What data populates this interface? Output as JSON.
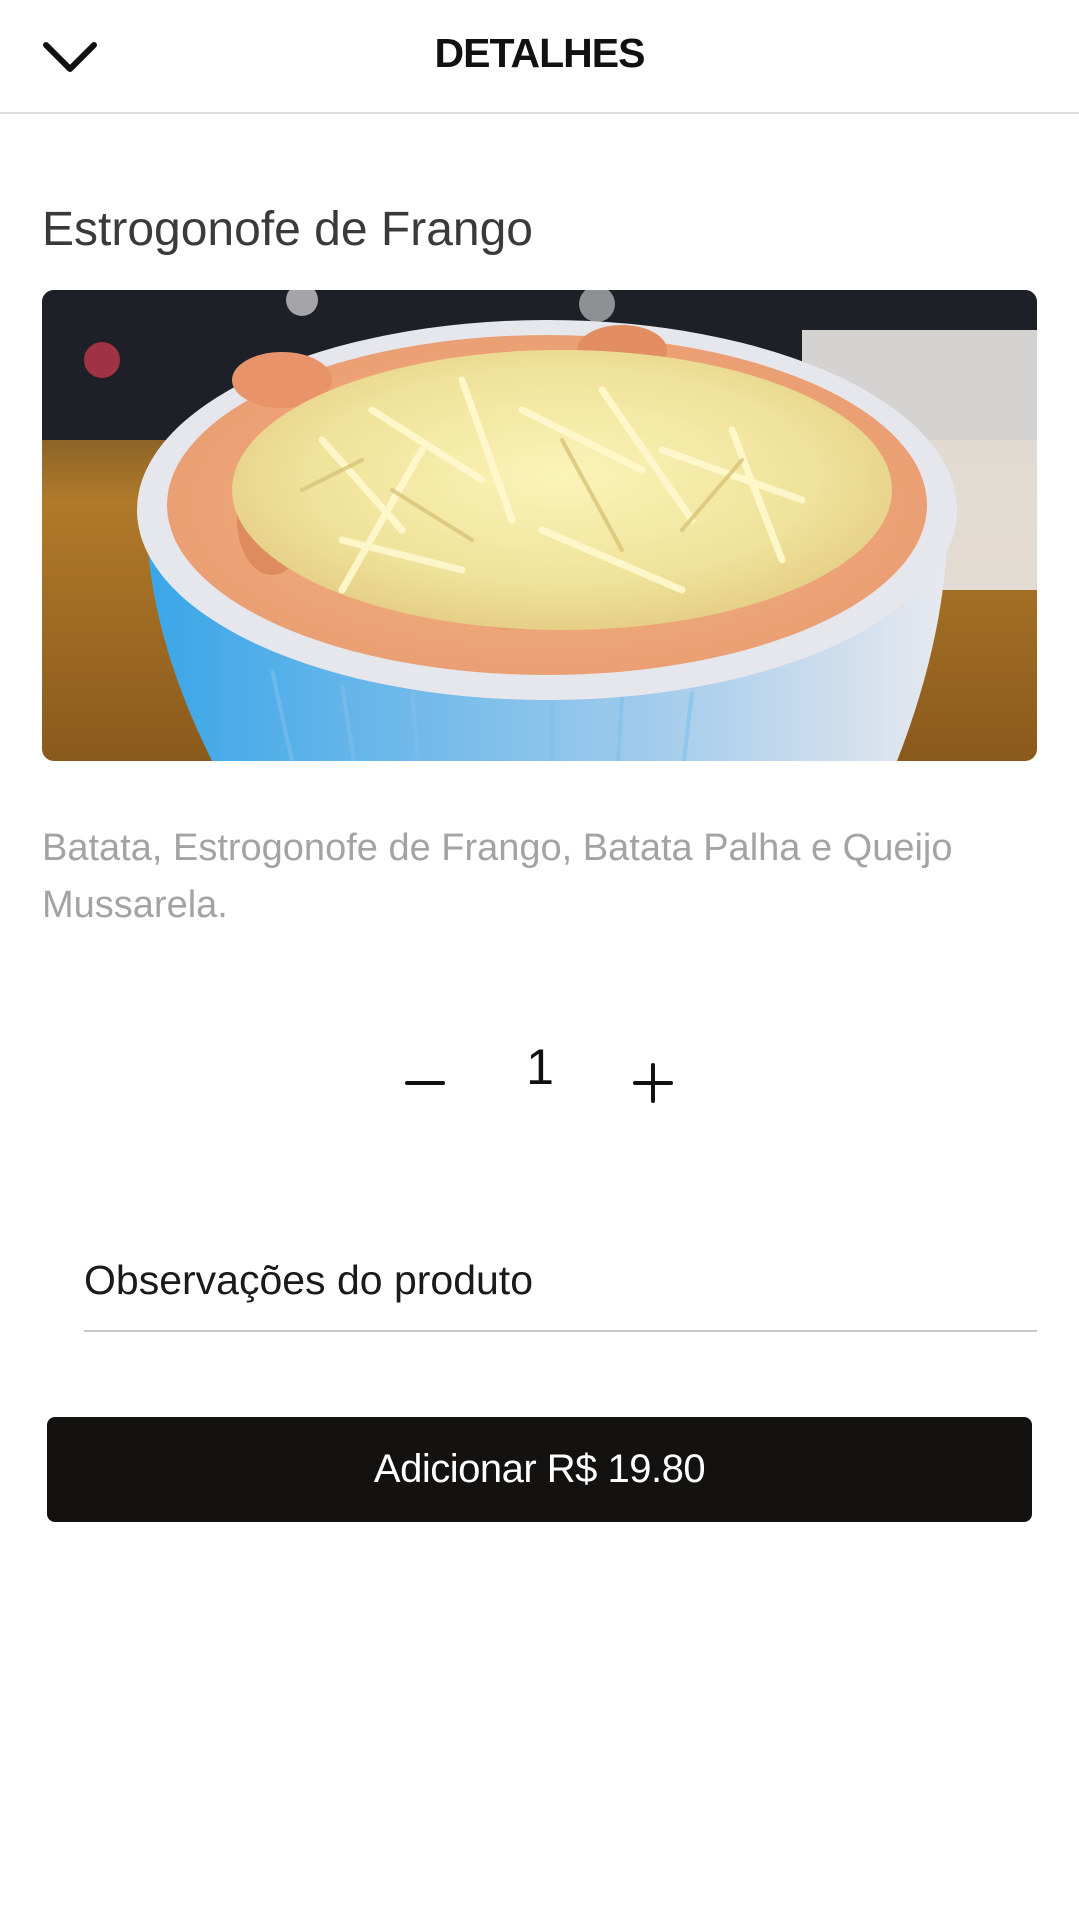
{
  "header": {
    "title": "DETALHES",
    "back_icon": "chevron-down-icon"
  },
  "product": {
    "name": "Estrogonofe de Frango",
    "image_alt": "Estrogonofe de Frango",
    "description": "Batata, Estrogonofe de Frango, Batata Palha e Queijo Mussarela."
  },
  "quantity": {
    "value": "1",
    "minus_icon": "minus-icon",
    "plus_icon": "plus-icon"
  },
  "notes": {
    "placeholder": "Observações do produto",
    "value": ""
  },
  "add_button": {
    "label": "Adicionar R$ 19.80"
  },
  "colors": {
    "button_background": "#131211",
    "button_text": "#ffffff",
    "description_text": "#a3a3a3",
    "divider": "#dedede"
  }
}
